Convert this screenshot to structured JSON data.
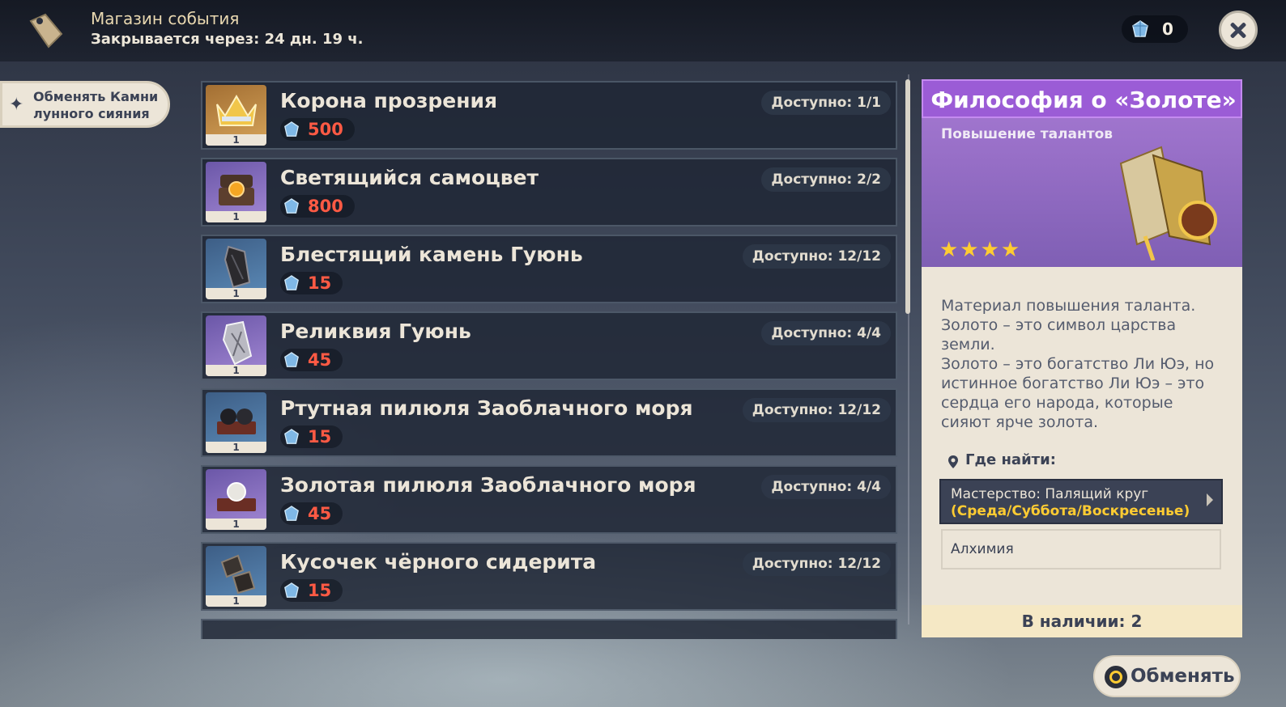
{
  "header": {
    "title": "Магазин события",
    "closing": "Закрывается через: 24 дн. 19 ч.",
    "currency_value": "0"
  },
  "exchange_button": {
    "label_line1": "Обменять Камни",
    "label_line2": "лунного сияния"
  },
  "items": [
    {
      "name": "Корона прозрения",
      "price": "500",
      "available": "Доступно: 1/1",
      "count": "1",
      "icon": "crown-icon"
    },
    {
      "name": "Светящийся самоцвет",
      "price": "800",
      "available": "Доступно: 2/2",
      "count": "1",
      "icon": "gem-chest-icon"
    },
    {
      "name": "Блестящий камень Гуюнь",
      "price": "15",
      "available": "Доступно: 12/12",
      "count": "1",
      "icon": "dark-stone-icon"
    },
    {
      "name": "Реликвия Гуюнь",
      "price": "45",
      "available": "Доступно: 4/4",
      "count": "1",
      "icon": "relic-icon"
    },
    {
      "name": "Ртутная пилюля Заоблачного моря",
      "price": "15",
      "available": "Доступно: 12/12",
      "count": "1",
      "icon": "black-pills-icon"
    },
    {
      "name": "Золотая пилюля Заоблачного моря",
      "price": "45",
      "available": "Доступно: 4/4",
      "count": "1",
      "icon": "pearl-pill-icon"
    },
    {
      "name": "Кусочек чёрного сидерита",
      "price": "15",
      "available": "Доступно: 12/12",
      "count": "1",
      "icon": "siderite-icon"
    }
  ],
  "detail": {
    "title": "Философия о «Золоте»",
    "type": "Повышение талантов",
    "stars": "★★★★",
    "rarity": 4,
    "description": "Материал повышения таланта.\nЗолото – это символ царства земли.\nЗолото – это богатство Ли Юэ, но истинное богатство Ли Юэ – это сердца его народа, которые сияют ярче золота.",
    "where_label": "Где найти:",
    "source1_line1": "Мастерство: Палящий круг",
    "source1_line2": "(Среда/Суббота/Воскресенье)",
    "source2": "Алхимия",
    "stock": "В наличии: 2"
  },
  "buy_button": {
    "label": "Обменять"
  },
  "colors": {
    "price_red": "#ff5a44",
    "title_purple": "#9b5cd6",
    "star_gold": "#ffcc32",
    "panel_cream": "#ece5d8"
  }
}
